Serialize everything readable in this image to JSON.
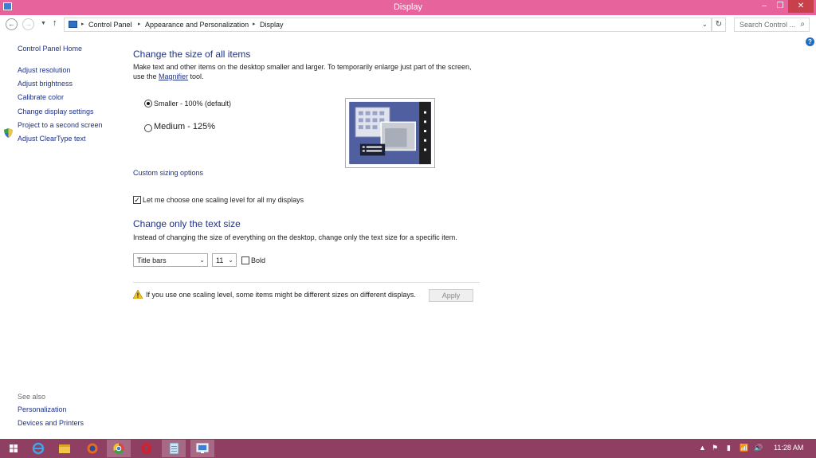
{
  "window": {
    "title": "Display",
    "min_glyph": "–",
    "max_glyph": "❐",
    "close_glyph": "✕"
  },
  "address": {
    "back_glyph": "←",
    "forward_glyph": "→",
    "recent_glyph": "▼",
    "up_glyph": "↑",
    "breadcrumbs": [
      "Control Panel",
      "Appearance and Personalization",
      "Display"
    ],
    "separator_glyph": "▸",
    "dropdown_glyph": "⌄",
    "refresh_glyph": "↻",
    "search_placeholder": "Search Control ...",
    "search_glyph": "⌕"
  },
  "help_glyph": "?",
  "sidebar": {
    "home": "Control Panel Home",
    "items": [
      "Adjust resolution",
      "Adjust brightness",
      "Calibrate color",
      "Change display settings",
      "Project to a second screen",
      "Adjust ClearType text"
    ],
    "see_also_label": "See also",
    "see_also": [
      "Personalization",
      "Devices and Printers"
    ]
  },
  "size_section": {
    "heading": "Change the size of all items",
    "desc_line1": "Make text and other items on the desktop smaller and larger. To temporarily enlarge just part of the screen,",
    "desc_line2_pre": "use the ",
    "desc_link": "Magnifier",
    "desc_line2_post": " tool.",
    "options": [
      {
        "label": "Smaller - 100% (default)",
        "checked": true
      },
      {
        "label": "Medium - 125%",
        "checked": false
      }
    ],
    "custom_link": "Custom sizing options",
    "one_level_label": "Let me choose one scaling level for all my displays",
    "one_level_checked": true
  },
  "text_section": {
    "heading": "Change only the text size",
    "desc": "Instead of changing the size of everything on the desktop, change only the text size for a specific item.",
    "item_select": "Title bars",
    "size_select": "11",
    "select_arrow": "⌄",
    "bold_label": "Bold",
    "bold_checked": false
  },
  "warning_text": "If you use one scaling level, some items might be different sizes on different displays.",
  "apply_label": "Apply",
  "colors": {
    "titlebar": "#e7639b",
    "taskbar": "#8f3f62",
    "link": "#1e3287",
    "preview_bg": "#4f5f9f"
  },
  "taskbar": {
    "items": [
      "start-icon",
      "internet-explorer-icon",
      "file-explorer-icon",
      "firefox-icon",
      "chrome-icon",
      "opera-icon",
      "notepad-icon",
      "control-panel-icon"
    ],
    "tray_glyphs": [
      "▲",
      "⚑",
      "▮",
      "📶",
      "🔊"
    ],
    "time": "11:28 AM"
  }
}
